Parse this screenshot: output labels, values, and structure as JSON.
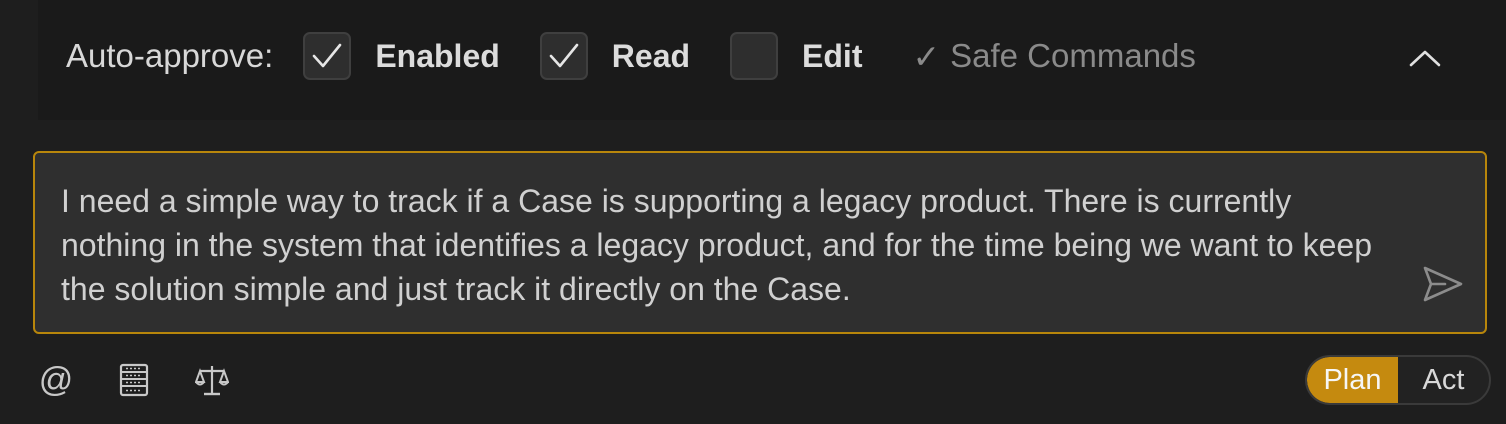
{
  "auto_approve": {
    "label": "Auto-approve:",
    "options": [
      {
        "label": "Enabled",
        "checked": true
      },
      {
        "label": "Read",
        "checked": true
      },
      {
        "label": "Edit",
        "checked": false
      }
    ],
    "safe_commands": {
      "check": "✓",
      "label": "Safe Commands"
    },
    "collapse_icon": "chevron-up-icon"
  },
  "input": {
    "value": "I need a simple way to track if a Case is supporting a legacy product. There is currently nothing in the system that identifies a legacy product, and for the time being we want to keep the solution simple and just track it directly on the Case.",
    "send_icon": "send-icon"
  },
  "toolbar": {
    "mention_symbol": "@",
    "tools": [
      "at-mention-icon",
      "server-icon",
      "scale-icon"
    ]
  },
  "mode": {
    "options": [
      "Plan",
      "Act"
    ],
    "active": "Plan"
  },
  "colors": {
    "accent": "#c58a0f",
    "input_border": "#b8860b",
    "background": "#1e1e1e"
  }
}
